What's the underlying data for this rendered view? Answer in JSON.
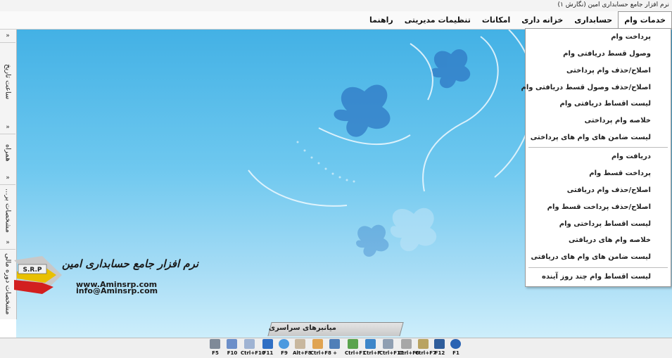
{
  "window": {
    "title": "نرم افزار جامع حسابداری امین (نگارش ۱)"
  },
  "menu": [
    "خدمات وام",
    "حسابداری",
    "خزانه داری",
    "امکانات",
    "تنظیمات مدیریتی",
    "راهنما"
  ],
  "dropdown": {
    "group1": [
      "پرداخت وام",
      "وصول قسط دریافتی وام",
      "اصلاح/حذف وام پرداختی",
      "اصلاح/حذف وصول قسط دریافتی وام",
      "لیست اقساط دریافتی وام",
      "خلاصه وام پرداختی",
      "لیست ضامن های وام های پرداختی"
    ],
    "group2": [
      "دریافت وام",
      "پرداخت قسط وام",
      "اصلاح/حذف وام دریافتی",
      "اصلاح/حذف پرداخت قسط وام",
      "لیست اقساط پرداختی وام",
      "خلاصه وام های دریافتی",
      "لیست ضامن های وام های دریافتی"
    ],
    "group3": [
      "لیست اقساط وام چند روز آینده"
    ]
  },
  "sidebar": {
    "arrow": "»",
    "panels": [
      "ساعت تاریخ",
      "همراه",
      "مشخصات بر...",
      "مشخصات دوره مالی"
    ]
  },
  "logo": {
    "mark": "S.R.P",
    "title": "نرم افزار جامع حسابداری امین",
    "url": "www.Aminsrp.com",
    "email": "info@Aminsrp.com"
  },
  "bottom_tab": {
    "label": "میانبرهای سراسری"
  },
  "toolbar": [
    {
      "label": "F5",
      "icon": "calculator-icon",
      "color": "#7f8a98"
    },
    {
      "label": "F10",
      "icon": "document-icon",
      "color": "#6c8fc9"
    },
    {
      "label": "Ctrl+F10",
      "icon": "notepad-icon",
      "color": "#9fb3d3"
    },
    {
      "label": "F11",
      "icon": "mail-icon",
      "color": "#2f6fc4"
    },
    {
      "label": "F9",
      "icon": "search-icon",
      "color": "#4c9adf"
    },
    {
      "label": "Alt+F8",
      "icon": "cheque-icon",
      "color": "#c8b79e"
    },
    {
      "label": "Ctrl+F8",
      "icon": "report-icon",
      "color": "#e0a452"
    },
    {
      "label": "+",
      "icon": "form-icon",
      "color": "#4f7fb8"
    },
    {
      "label": "Ctrl+F1",
      "icon": "table-icon",
      "color": "#5aa34d"
    },
    {
      "label": "Ctrl+F",
      "icon": "network-icon",
      "color": "#3d86c9"
    },
    {
      "label": "Ctrl+F10",
      "icon": "list-icon",
      "color": "#8f9fb2"
    },
    {
      "label": "Ctrl+F6",
      "icon": "pen-icon",
      "color": "#a7a7a7"
    },
    {
      "label": "Ctrl+F7",
      "icon": "money-icon",
      "color": "#b9a361"
    },
    {
      "label": "F12",
      "icon": "screen-icon",
      "color": "#2f5d9b"
    },
    {
      "label": "F1",
      "icon": "help-icon",
      "color": "#2a63b3"
    }
  ]
}
